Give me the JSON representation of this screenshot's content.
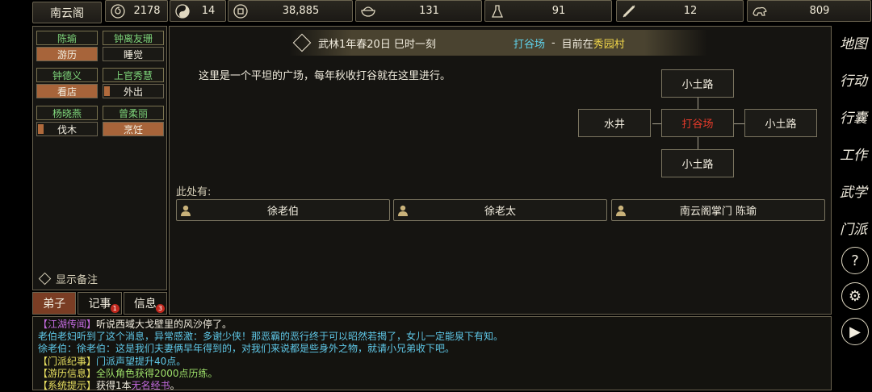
{
  "sect_name": "南云阁",
  "resources": [
    {
      "icon": "spiral-icon",
      "value": "2178"
    },
    {
      "icon": "yin-yang-icon",
      "value": "14"
    },
    {
      "icon": "coin-icon",
      "value": "38,885"
    },
    {
      "icon": "rice-bowl-icon",
      "value": "131"
    },
    {
      "icon": "flask-icon",
      "value": "91"
    },
    {
      "icon": "scroll-icon",
      "value": "12"
    },
    {
      "icon": "beast-icon",
      "value": "809"
    }
  ],
  "disciples": [
    {
      "name": "陈瑜",
      "status": "游历",
      "busy": true
    },
    {
      "name": "钟离友珊",
      "status": "睡觉",
      "busy": false
    },
    {
      "name": "钟德义",
      "status": "看店",
      "busy": true
    },
    {
      "name": "上官秀慧",
      "status": "外出",
      "busy": false
    },
    {
      "name": "杨晓燕",
      "status": "伐木",
      "busy": false
    },
    {
      "name": "曾柔丽",
      "status": "烹饪",
      "busy": true
    }
  ],
  "show_note_label": "显示备注",
  "tabs": [
    {
      "label": "弟子",
      "badge": ""
    },
    {
      "label": "记事",
      "badge": "1"
    },
    {
      "label": "信息",
      "badge": "3"
    }
  ],
  "header": {
    "date": "武林1年春20日 巳时一刻",
    "location": "打谷场",
    "separator": "-",
    "currently_at": "目前在",
    "village": "秀园村"
  },
  "description": "这里是一个平坦的广场，每年秋收打谷就在这里进行。",
  "map": {
    "north": "小土路",
    "west": "水井",
    "center": "打谷场",
    "east": "小土路",
    "south": "小土路"
  },
  "here_label": "此处有:",
  "npcs": [
    "徐老伯",
    "徐老太",
    "南云阁掌门 陈瑜"
  ],
  "side_menu": [
    "地图",
    "行动",
    "行囊",
    "工作",
    "武学",
    "门派"
  ],
  "log": [
    {
      "tag": "【江湖传闻】",
      "text": "听说西域大戈壁里的风沙停了。"
    },
    {
      "tag": "",
      "text": "老伯老妇听到了这个消息，异常感激：多谢少侠！那恶霸的恶行终于可以昭然若揭了，女儿一定能泉下有知。"
    },
    {
      "tag": "",
      "text": "徐老伯：徐老伯：这是我们夫妻俩早年得到的，对我们来说都是些身外之物，就请小兄弟收下吧。"
    },
    {
      "tag": "【门派纪事】",
      "text": "门派声望提升40点。"
    },
    {
      "tag": "【游历信息】",
      "text": "全队角色获得2000点历练。"
    },
    {
      "tag": "【系统提示】",
      "text": "获得1本",
      "item": "无名经书",
      "end": "。"
    }
  ]
}
